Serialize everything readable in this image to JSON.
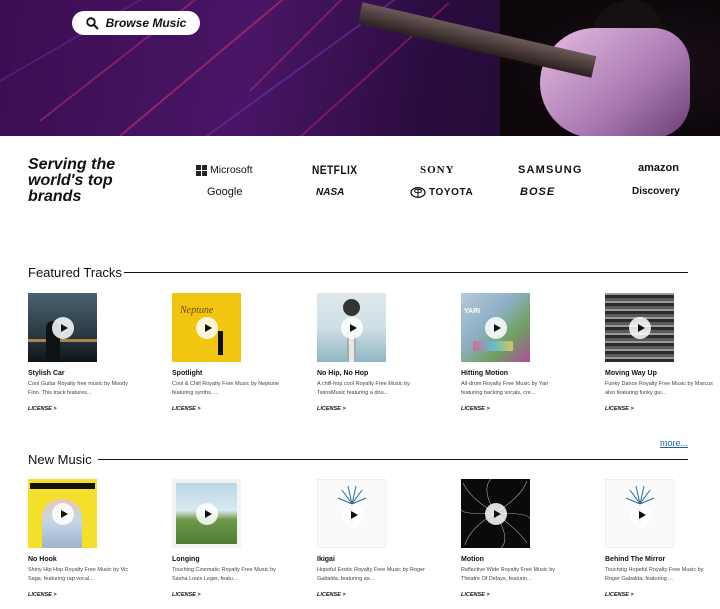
{
  "hero": {
    "browse_label": "Browse Music"
  },
  "brands": {
    "tagline": "Serving the world's top brands",
    "logos": [
      "Microsoft",
      "NETFLIX",
      "SONY",
      "SAMSUNG",
      "amazon",
      "Google",
      "NASA",
      "TOYOTA",
      "BOSE",
      "Discovery"
    ]
  },
  "featured": {
    "title": "Featured Tracks",
    "more": "more...",
    "tracks": [
      {
        "title": "Stylish Car",
        "desc": "Cool Guitar Royalty free music by Moody Finn. This track features...",
        "license": "LICENSE >"
      },
      {
        "title": "Spotlight",
        "desc": "Cool & Chill Royalty Free Music by Neptune featuring synths, ...",
        "license": "LICENSE >"
      },
      {
        "title": "No Hip, No Hop",
        "desc": "A chill-hop cool Royalty Free Music by TwinsMusic featuring a dou...",
        "license": "LICENSE >"
      },
      {
        "title": "Hitting Motion",
        "desc": "All-drum Royalty Free Music by Yari featuring backing vocals, cre...",
        "license": "LICENSE >"
      },
      {
        "title": "Moving Way Up",
        "desc": "Funky Dance Royalty Free Music by Marcus also featuring funky gui...",
        "license": "LICENSE >"
      }
    ]
  },
  "new_music": {
    "title": "New Music",
    "tracks": [
      {
        "title": "No Hook",
        "desc": "Shiny Hip Hop Royalty Free Music by Vic Sage, featuring rap vocal...",
        "license": "LICENSE >"
      },
      {
        "title": "Longing",
        "desc": "Touching Cinematic Royalty Free Music by Sasha Louis Leger, featu...",
        "license": "LICENSE >"
      },
      {
        "title": "Ikigai",
        "desc": "Hopeful Exotic Royalty Free Music by Roger Gabalda, featuring as...",
        "license": "LICENSE >"
      },
      {
        "title": "Motion",
        "desc": "Reflective Wide Royalty Free Music by Theatre Of Delays, featurin...",
        "license": "LICENSE >"
      },
      {
        "title": "Behind The Mirror",
        "desc": "Touching Hopeful Royalty Free Music by Roger Gabalda, featuring ...",
        "license": "LICENSE >"
      }
    ]
  },
  "colors": {
    "hero_purple": "#3a0d52",
    "link_blue": "#1a5fb4",
    "text": "#111111"
  }
}
